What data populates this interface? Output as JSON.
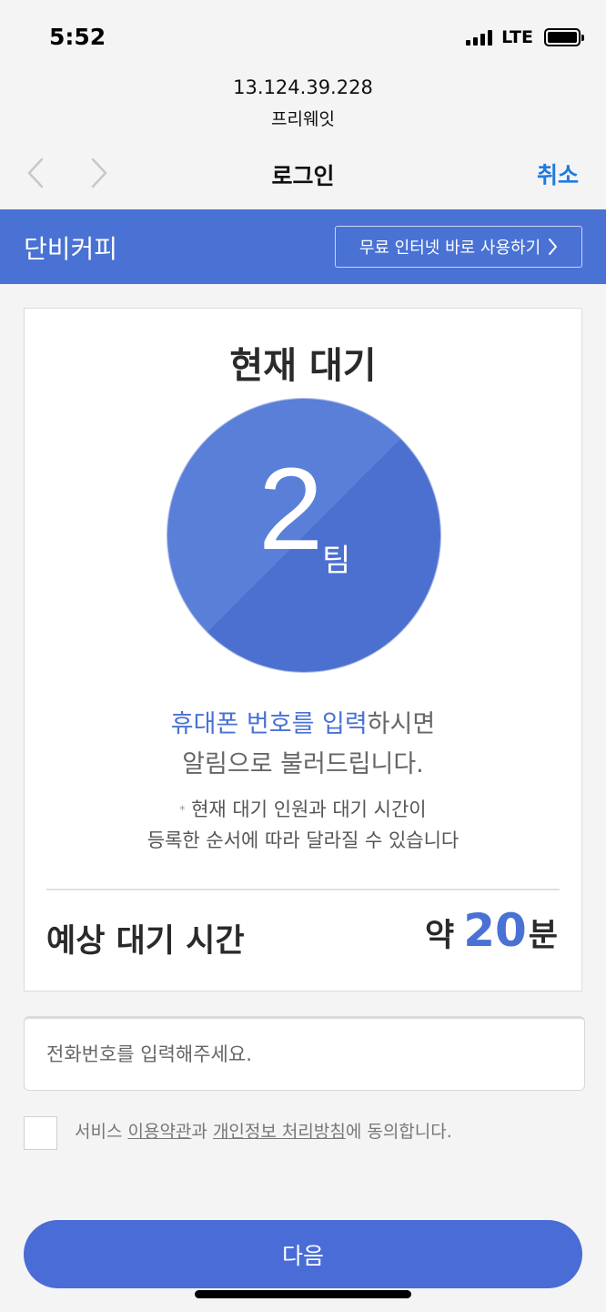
{
  "status_bar": {
    "time": "5:52",
    "network": "LTE"
  },
  "portal": {
    "host": "13.124.39.228",
    "ssid": "프리웨잇",
    "title": "로그인",
    "cancel_label": "취소"
  },
  "brand": {
    "name": "단비커피",
    "free_internet_label": "무료 인터넷 바로 사용하기",
    "color": "#4a72d4"
  },
  "queue": {
    "title": "현재 대기",
    "count": "2",
    "unit": "팀",
    "notify_highlight": "휴대폰 번호를 입력",
    "notify_rest": "하시면",
    "notify_line2": "알림으로 불러드립니다.",
    "note_star": "*",
    "note_line1": "현재 대기 인원과 대기 시간이",
    "note_line2": "등록한 순서에 따라 달라질 수 있습니다",
    "wait_label": "예상 대기 시간",
    "wait_prefix": "약",
    "wait_minutes": "20",
    "wait_suffix": "분"
  },
  "form": {
    "phone_placeholder": "전화번호를 입력해주세요.",
    "agree_prefix": "서비스 ",
    "agree_terms": "이용약관",
    "agree_mid": "과 ",
    "agree_privacy": "개인정보 처리방침",
    "agree_suffix": "에 동의합니다.",
    "next_label": "다음"
  },
  "colors": {
    "accent": "#4a72d4",
    "link_blue": "#1f7be0"
  }
}
